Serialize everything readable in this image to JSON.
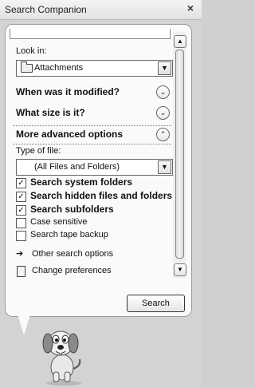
{
  "window": {
    "title": "Search Companion",
    "close_glyph": "×"
  },
  "look_in": {
    "label": "Look in:",
    "value": "Attachments"
  },
  "sections": {
    "modified": "When was it modified?",
    "size": "What size is it?",
    "advanced": "More advanced options"
  },
  "type_of_file": {
    "label": "Type of file:",
    "value": "(All Files and Folders)"
  },
  "options": [
    {
      "label": "Search system folders",
      "checked": true,
      "bold": true
    },
    {
      "label": "Search hidden files and folders",
      "checked": true,
      "bold": true
    },
    {
      "label": "Search subfolders",
      "checked": true,
      "bold": true
    },
    {
      "label": "Case sensitive",
      "checked": false,
      "bold": false
    },
    {
      "label": "Search tape backup",
      "checked": false,
      "bold": false
    }
  ],
  "links": {
    "other_options": "Other search options",
    "change_prefs": "Change preferences"
  },
  "buttons": {
    "search": "Search"
  },
  "glyphs": {
    "chev_down": "⌄",
    "chev_up": "⌃",
    "check": "✓",
    "arrow_right": "➔",
    "dropdown": "▼",
    "scroll_up": "▲",
    "scroll_down": "▼"
  }
}
